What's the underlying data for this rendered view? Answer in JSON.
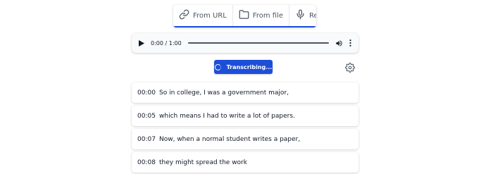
{
  "tabs": [
    {
      "label": "From URL",
      "icon": "link-icon"
    },
    {
      "label": "From file",
      "icon": "folder-icon"
    },
    {
      "label": "Record",
      "icon": "microphone-icon"
    }
  ],
  "player": {
    "time_display": "0:00 / 1:00",
    "progress": 0
  },
  "status_button": {
    "label": "Transcribing..."
  },
  "settings": {
    "icon": "gear-icon"
  },
  "segments": [
    {
      "time": "00:00",
      "text": "So in college, I was a government major,"
    },
    {
      "time": "00:05",
      "text": "which means I had to write a lot of papers."
    },
    {
      "time": "00:07",
      "text": "Now, when a normal student writes a paper,"
    },
    {
      "time": "00:08",
      "text": "they might spread the work"
    }
  ],
  "colors": {
    "accent": "#1d4ed8",
    "tab_text": "#4b5563"
  }
}
